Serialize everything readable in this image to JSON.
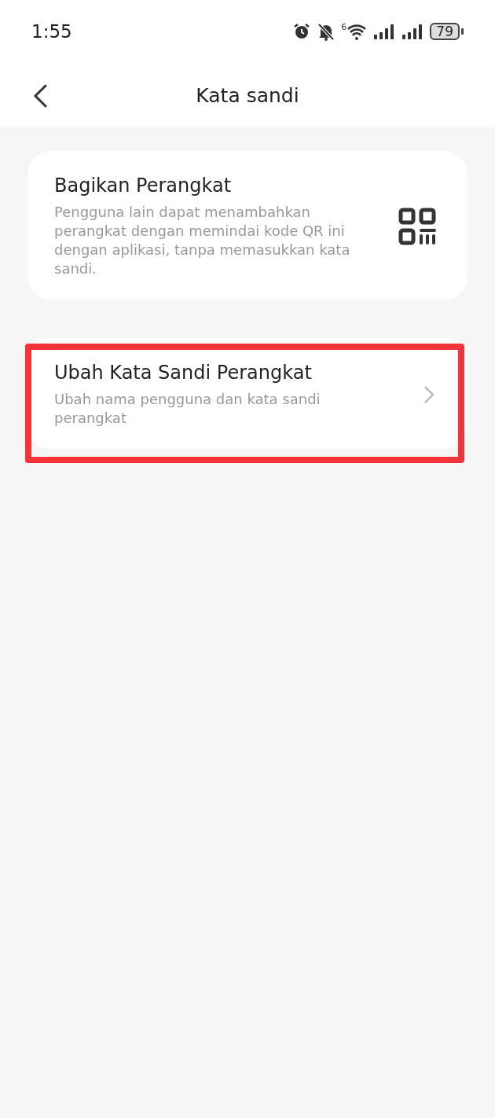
{
  "status_bar": {
    "time": "1:55",
    "wifi_label": "6",
    "battery": "79"
  },
  "header": {
    "title": "Kata sandi"
  },
  "items": [
    {
      "kind": "qr",
      "title": "Bagikan Perangkat",
      "description": "Pengguna lain dapat menambahkan perangkat dengan memindai kode QR ini dengan aplikasi, tanpa memasukkan kata sandi.",
      "highlighted": false
    },
    {
      "kind": "link",
      "title": "Ubah Kata Sandi Perangkat",
      "description": "Ubah nama pengguna dan kata sandi perangkat",
      "highlighted": true
    }
  ]
}
